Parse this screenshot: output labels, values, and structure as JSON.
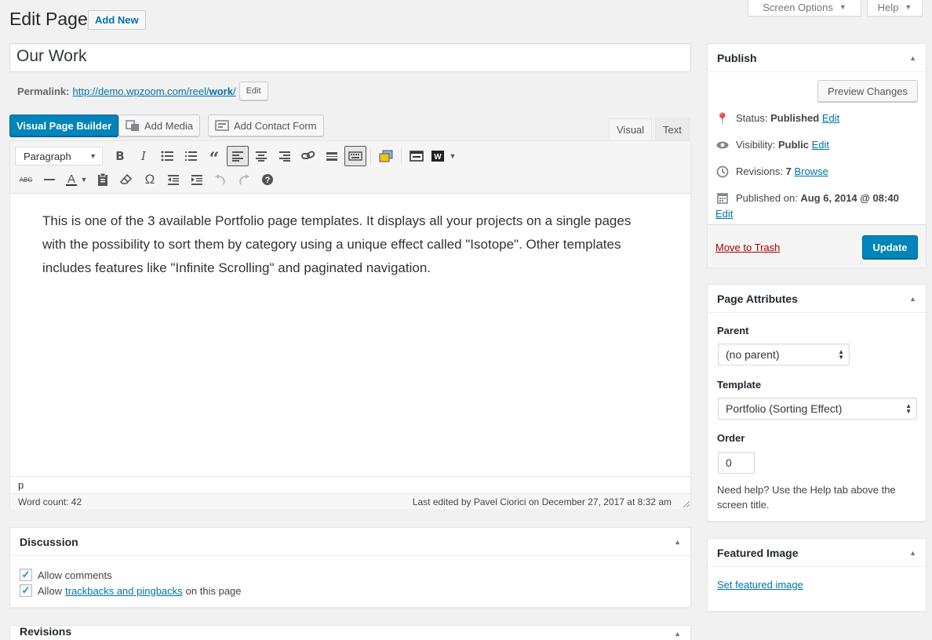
{
  "screen_meta": {
    "screen_options": "Screen Options",
    "help": "Help"
  },
  "header": {
    "title": "Edit Page",
    "add_new": "Add New"
  },
  "post_title": "Our Work",
  "permalink": {
    "label": "Permalink:",
    "url_base": "http://demo.wpzoom.com/reel/",
    "slug": "work",
    "url_end": "/",
    "edit": "Edit"
  },
  "media_buttons": {
    "vpb": "Visual Page Builder",
    "add_media": "Add Media",
    "add_contact_form": "Add Contact Form"
  },
  "editor_tabs": {
    "visual": "Visual",
    "text": "Text"
  },
  "toolbar": {
    "format": "Paragraph"
  },
  "content": "This is one of the 3 available Portfolio page templates. It displays all your projects on a single pages with the possibility to sort them by category using a unique effect called \"Isotope\". Other templates includes features like \"Infinite Scrolling\" and paginated navigation.",
  "path": "p",
  "status": {
    "word_count": "Word count: 42",
    "last_edited": "Last edited by Pavel Ciorici on December 27, 2017 at 8:32 am"
  },
  "discussion": {
    "title": "Discussion",
    "allow_comments": "Allow comments",
    "allow_prefix": "Allow",
    "trackbacks_link": "trackbacks and pingbacks",
    "trackbacks_suffix": "on this page"
  },
  "revisions_box": {
    "title": "Revisions"
  },
  "publish": {
    "title": "Publish",
    "preview": "Preview Changes",
    "status_label": "Status:",
    "status_value": "Published",
    "status_edit": "Edit",
    "visibility_label": "Visibility:",
    "visibility_value": "Public",
    "visibility_edit": "Edit",
    "revisions_label": "Revisions:",
    "revisions_value": "7",
    "revisions_browse": "Browse",
    "published_label": "Published on:",
    "published_value": "Aug 6, 2014 @ 08:40",
    "published_edit": "Edit",
    "trash": "Move to Trash",
    "update": "Update"
  },
  "page_attributes": {
    "title": "Page Attributes",
    "parent_label": "Parent",
    "parent_value": "(no parent)",
    "template_label": "Template",
    "template_value": "Portfolio (Sorting Effect)",
    "order_label": "Order",
    "order_value": "0",
    "help": "Need help? Use the Help tab above the screen title."
  },
  "featured_image": {
    "title": "Featured Image",
    "link": "Set featured image"
  },
  "colors": {
    "primary": "#0085ba",
    "link": "#0073aa",
    "trash": "#a00",
    "bg": "#f1f1f1"
  }
}
